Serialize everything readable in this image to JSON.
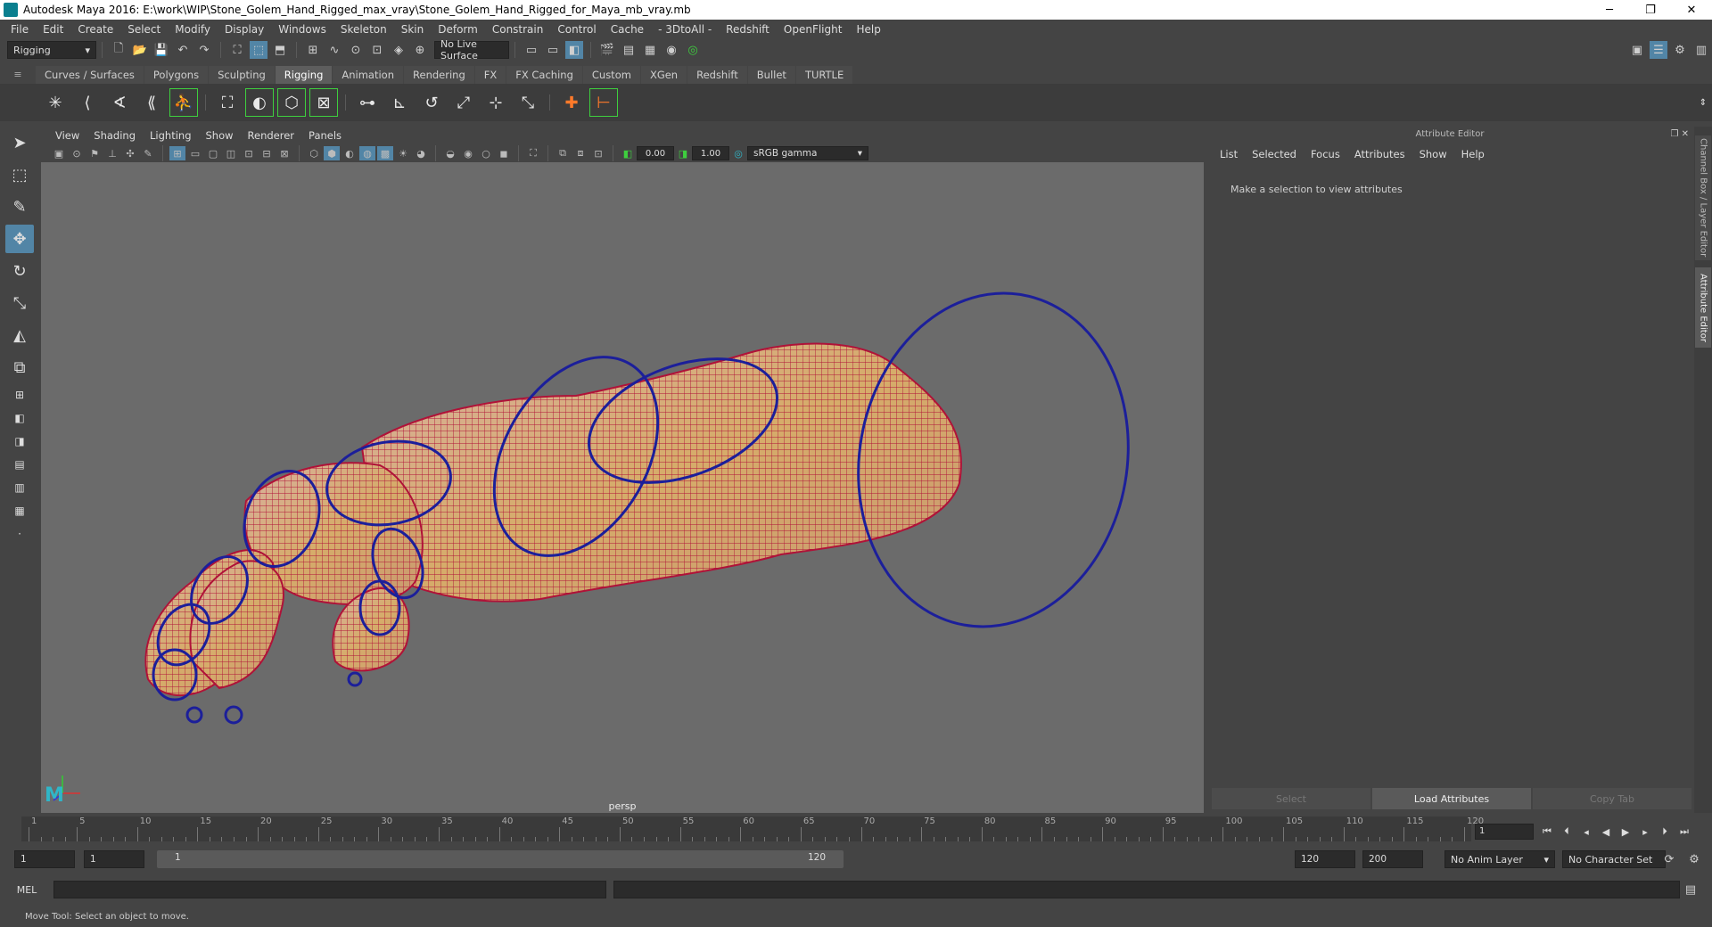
{
  "window": {
    "title": "Autodesk Maya 2016: E:\\work\\WIP\\Stone_Golem_Hand_Rigged_max_vray\\Stone_Golem_Hand_Rigged_for_Maya_mb_vray.mb",
    "minimize": "─",
    "restore": "❐",
    "close": "✕"
  },
  "menubar": [
    "File",
    "Edit",
    "Create",
    "Select",
    "Modify",
    "Display",
    "Windows",
    "Skeleton",
    "Skin",
    "Deform",
    "Constrain",
    "Control",
    "Cache",
    "- 3DtoAll -",
    "Redshift",
    "OpenFlight",
    "Help"
  ],
  "statusline": {
    "menuset": "Rigging",
    "live_surface": "No Live Surface"
  },
  "shelf_tabs": {
    "tabs": [
      "Curves / Surfaces",
      "Polygons",
      "Sculpting",
      "Rigging",
      "Animation",
      "Rendering",
      "FX",
      "FX Caching",
      "Custom",
      "XGen",
      "Redshift",
      "Bullet",
      "TURTLE"
    ],
    "active": "Rigging"
  },
  "viewport": {
    "menus": [
      "View",
      "Shading",
      "Lighting",
      "Show",
      "Renderer",
      "Panels"
    ],
    "exposure": "0.00",
    "gamma": "1.00",
    "color_space": "sRGB gamma",
    "camera": "persp"
  },
  "attribute_editor": {
    "title": "Attribute Editor",
    "menus": [
      "List",
      "Selected",
      "Focus",
      "Attributes",
      "Show",
      "Help"
    ],
    "hint": "Make a selection to view attributes",
    "buttons": [
      "Select",
      "Load Attributes",
      "Copy Tab"
    ]
  },
  "side_tabs": [
    "Channel Box / Layer Editor",
    "Attribute Editor"
  ],
  "timeslider": {
    "ticks": [
      "1",
      "5",
      "10",
      "15",
      "20",
      "25",
      "30",
      "35",
      "40",
      "45",
      "50",
      "55",
      "60",
      "65",
      "70",
      "75",
      "80",
      "85",
      "90",
      "95",
      "100",
      "105",
      "110",
      "115",
      "120"
    ],
    "current_frame": "1"
  },
  "range": {
    "start": "1",
    "playback_start": "1",
    "slider_start": "1",
    "slider_end": "120",
    "playback_end": "120",
    "end": "200",
    "anim_layer": "No Anim Layer",
    "character_set": "No Character Set"
  },
  "cmdline": {
    "label": "MEL"
  },
  "helpline": "Move Tool: Select an object to move."
}
